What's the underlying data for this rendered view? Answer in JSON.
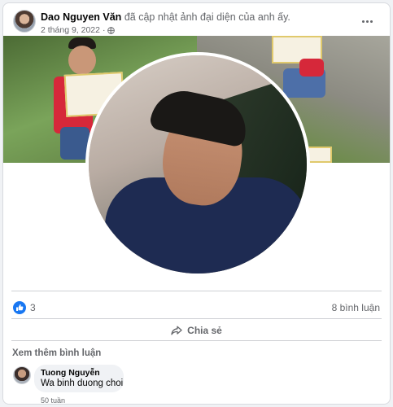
{
  "post": {
    "author": "Dao Nguyen Văn",
    "action": "đã cập nhật ảnh đại diện của anh ấy.",
    "timestamp": "2 tháng 9, 2022",
    "privacy_icon": "globe-icon",
    "more_icon": "more-horizontal-icon"
  },
  "stats": {
    "reactions": "3",
    "comments": "8 bình luận"
  },
  "actions": {
    "share_label": "Chia sẻ"
  },
  "comments_section": {
    "more_label": "Xem thêm bình luận",
    "items": [
      {
        "name": "Tuong Nguyễn",
        "text": "Wa binh duong choi",
        "time": "50 tuần"
      }
    ]
  },
  "colors": {
    "accent": "#1877f2",
    "secondary_text": "#65676b",
    "bubble": "#f0f2f5"
  }
}
